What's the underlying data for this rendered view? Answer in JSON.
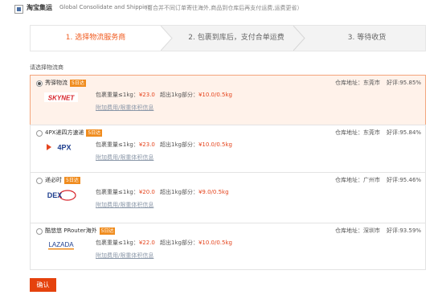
{
  "header": {
    "title": "淘宝集运",
    "subtitle_en": "Global Consolidate and Shipping",
    "note": "（可合并不同订单寄往海外,商品到仓库后再支付运费,运费更省）"
  },
  "steps": [
    {
      "label": "1. 选择物流服务商",
      "active": true
    },
    {
      "label": "2. 包裹到库后，支付合单运费",
      "active": false
    },
    {
      "label": "3. 等待收货",
      "active": false
    }
  ],
  "section_label": "请选择物流商",
  "services": [
    {
      "name": "秀驿物流",
      "badge": "5日达",
      "selected": true,
      "logo": "SKYNET",
      "pkg_label": "包裹重量≤1kg：",
      "pkg_price": "¥23.0",
      "over_label": "超出1kg部分：",
      "over_price": "¥10.0/0.5kg",
      "link": "附加费用/限重体积信息",
      "warehouse": "仓库地址：东莞市",
      "rating": "好评:95.85%"
    },
    {
      "name": "4PX递四方速递",
      "badge": "5日达",
      "selected": false,
      "logo": "4PX",
      "pkg_label": "包裹重量≤1kg：",
      "pkg_price": "¥23.0",
      "over_label": "超出1kg部分：",
      "over_price": "¥10.0/0.5kg",
      "link": "附加费用/限重体积信息",
      "warehouse": "仓库地址：东莞市",
      "rating": "好评:95.84%"
    },
    {
      "name": "递必时",
      "badge": "5日达",
      "selected": false,
      "logo": "DEX",
      "pkg_label": "包裹重量≤1kg：",
      "pkg_price": "¥20.0",
      "over_label": "超出1kg部分：",
      "over_price": "¥9.0/0.5kg",
      "link": "附加费用/限重体积信息",
      "warehouse": "仓库地址：广州市",
      "rating": "好评:95.46%"
    },
    {
      "name": "酷悠悠 PRouter海外",
      "badge": "5日达",
      "selected": false,
      "logo": "LAZADA",
      "pkg_label": "包裹重量≤1kg：",
      "pkg_price": "¥22.0",
      "over_label": "超出1kg部分：",
      "over_price": "¥10.0/0.5kg",
      "link": "附加费用/限重体积信息",
      "warehouse": "仓库地址：深圳市",
      "rating": "好评:93.59%"
    }
  ],
  "confirm_label": "确认",
  "colors": {
    "accent": "#e5420d",
    "price": "#e5451e",
    "badge": "#f08c1e",
    "selected_bg": "#fff2ea"
  }
}
